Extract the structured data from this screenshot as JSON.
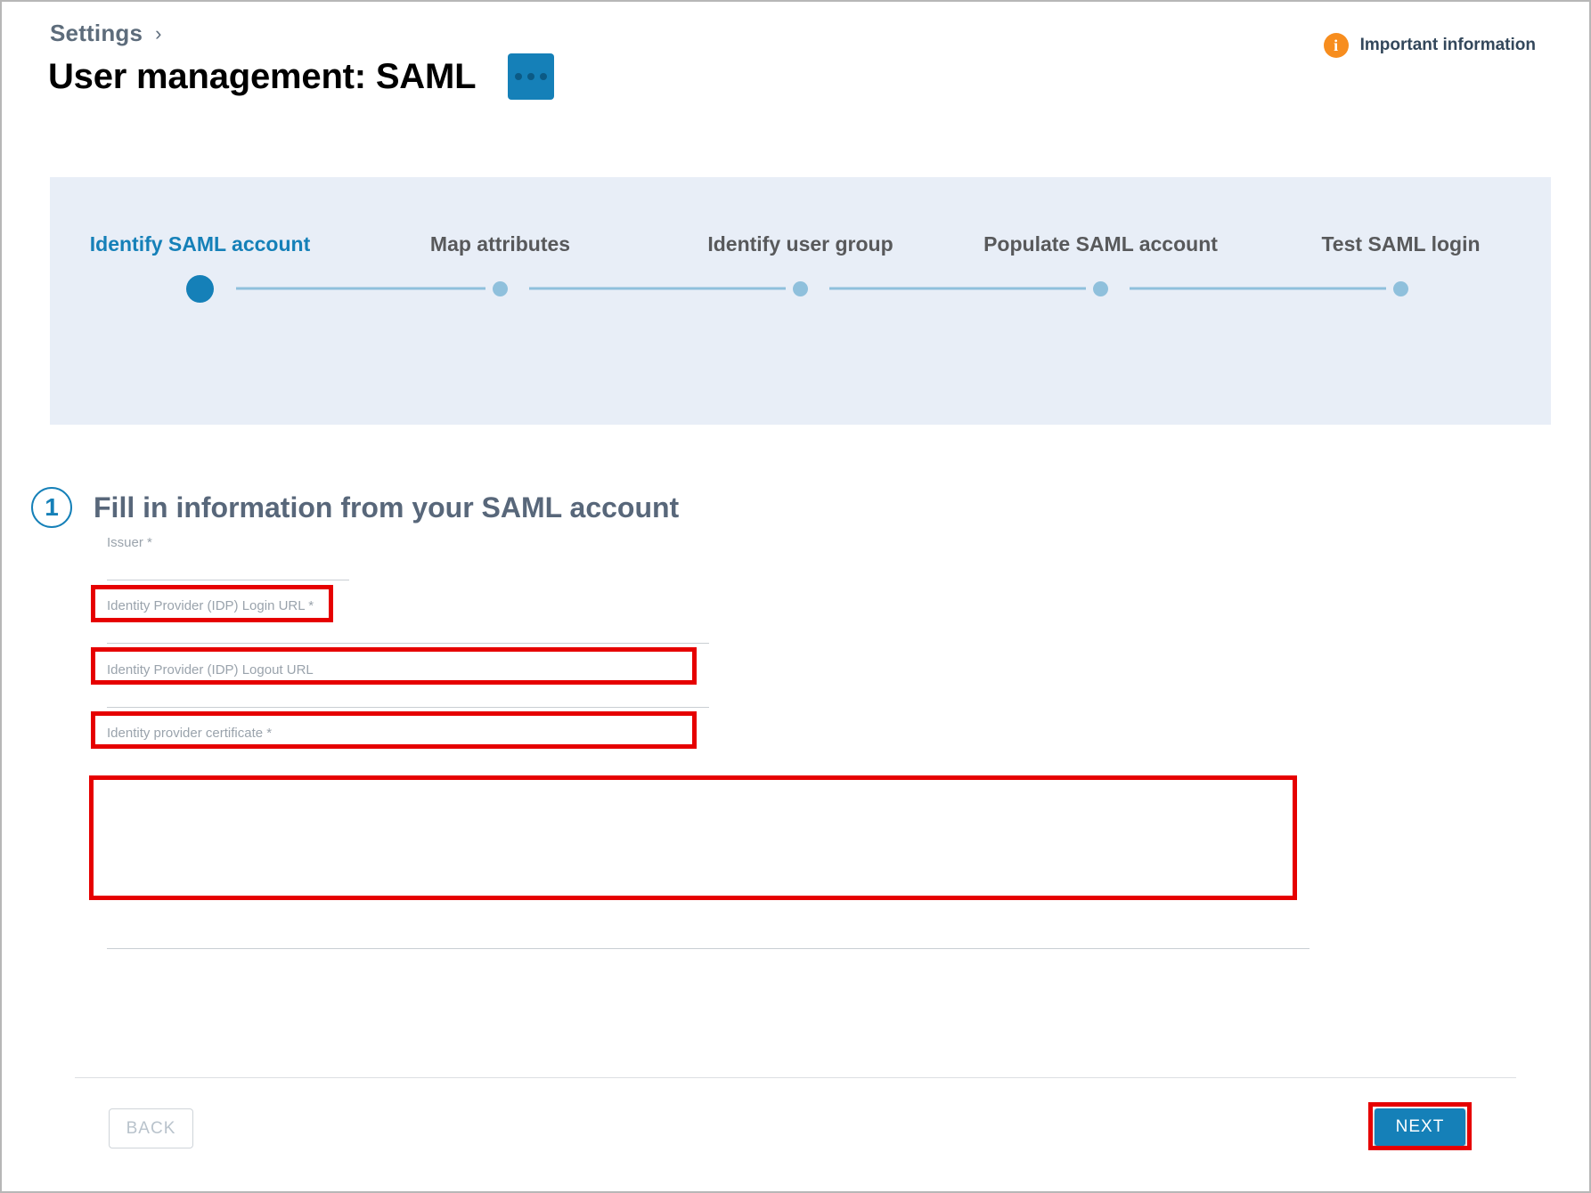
{
  "header": {
    "breadcrumb": "Settings",
    "breadcrumb_chevron": "›",
    "title": "User management: SAML",
    "kebab_label": "•••",
    "important_info_icon": "i",
    "important_info_label": "Important information"
  },
  "stepper": {
    "steps": [
      {
        "label": "Identify SAML account",
        "state": "active"
      },
      {
        "label": "Map attributes",
        "state": "pending"
      },
      {
        "label": "Identify user group",
        "state": "pending"
      },
      {
        "label": "Populate SAML account",
        "state": "pending"
      },
      {
        "label": "Test SAML login",
        "state": "pending"
      }
    ]
  },
  "section": {
    "number": "1",
    "title": "Fill in information from your SAML account"
  },
  "form": {
    "fields": [
      {
        "label": "Issuer *",
        "value": "",
        "placeholder": "",
        "type": "text"
      },
      {
        "label": "Identity Provider (IDP) Login URL *",
        "value": "",
        "placeholder": "",
        "type": "text"
      },
      {
        "label": "Identity Provider (IDP) Logout URL",
        "value": "",
        "placeholder": "",
        "type": "text"
      },
      {
        "label": "Identity provider certificate *",
        "value": "",
        "placeholder": "",
        "type": "textarea"
      }
    ]
  },
  "footer": {
    "back_label": "BACK",
    "next_label": "NEXT"
  },
  "annotations": {
    "color": "#e60000",
    "targets": [
      "issuer-field",
      "login-url-field",
      "logout-url-field",
      "certificate-field",
      "next-button"
    ]
  },
  "colors": {
    "accent_blue": "#1580b8",
    "stepper_bg": "#e8eef7",
    "step_pending": "#8fc0dc",
    "info_orange": "#f78d1e",
    "heading_gray": "#58677a",
    "label_gray": "#9aa3ac"
  }
}
